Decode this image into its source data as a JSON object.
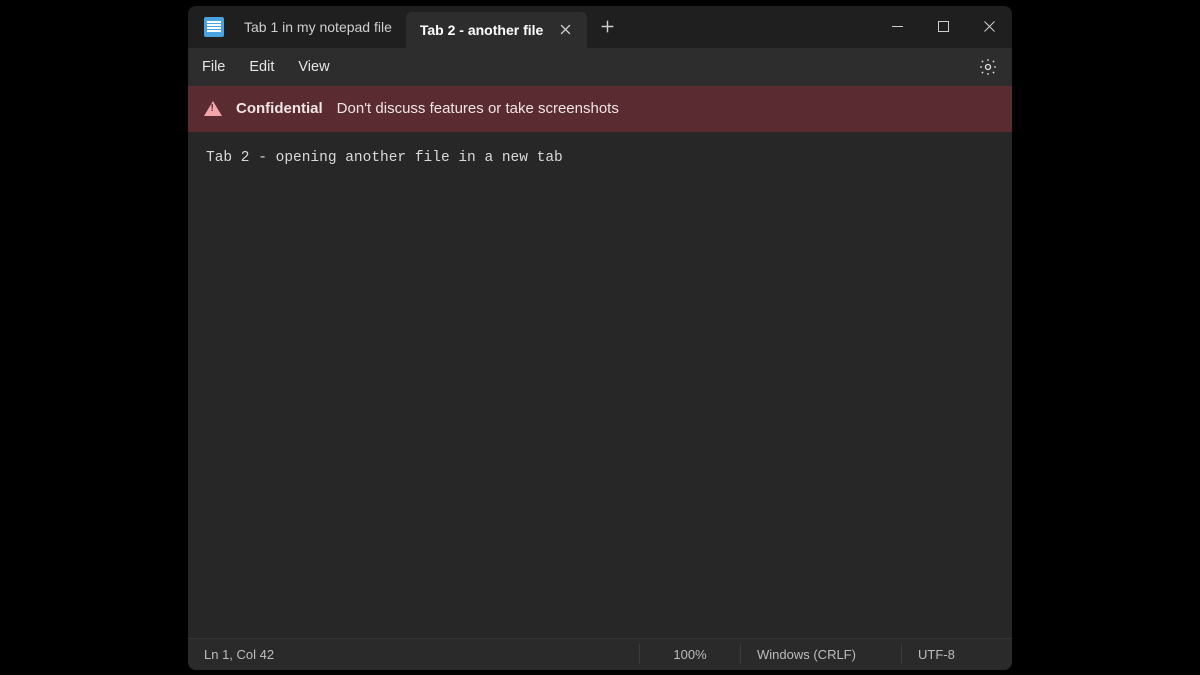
{
  "tabs": {
    "items": [
      {
        "label": "Tab 1 in my notepad file",
        "active": false
      },
      {
        "label": "Tab 2 - another file",
        "active": true
      }
    ]
  },
  "menubar": {
    "file": "File",
    "edit": "Edit",
    "view": "View"
  },
  "banner": {
    "strong": "Confidential",
    "message": "Don't discuss features or take screenshots"
  },
  "editor": {
    "content": "Tab 2 - opening another file in a new tab"
  },
  "statusbar": {
    "cursor": "Ln 1, Col 42",
    "zoom": "100%",
    "line_ending": "Windows (CRLF)",
    "encoding": "UTF-8"
  }
}
